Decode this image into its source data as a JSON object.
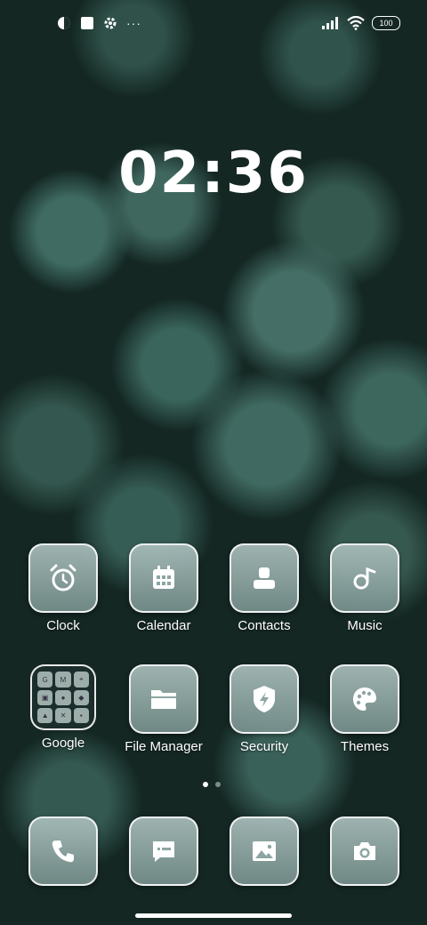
{
  "status_bar": {
    "icons_left": [
      "app-indicator-icon",
      "square-notification-icon",
      "gear-icon",
      "more-dots-icon"
    ],
    "more_label": "···",
    "icons_right": [
      "signal-icon",
      "wifi-icon",
      "battery-icon"
    ],
    "battery_level": "100"
  },
  "clock": {
    "time": "02:36"
  },
  "apps_row1": [
    {
      "label": "Clock",
      "icon": "alarm-clock-icon"
    },
    {
      "label": "Calendar",
      "icon": "calendar-icon"
    },
    {
      "label": "Contacts",
      "icon": "contacts-icon"
    },
    {
      "label": "Music",
      "icon": "music-note-icon"
    }
  ],
  "apps_row2": [
    {
      "label": "Google",
      "icon": "folder-icon"
    },
    {
      "label": "File Manager",
      "icon": "folder-open-icon"
    },
    {
      "label": "Security",
      "icon": "shield-bolt-icon"
    },
    {
      "label": "Themes",
      "icon": "palette-icon"
    }
  ],
  "google_folder_minis": [
    "G",
    "M",
    "⌖",
    "▣",
    "●",
    "◆",
    "▲",
    "✕",
    "▪"
  ],
  "dock": [
    {
      "icon": "phone-icon"
    },
    {
      "icon": "messages-icon"
    },
    {
      "icon": "gallery-icon"
    },
    {
      "icon": "camera-icon"
    }
  ],
  "page_indicator": {
    "pages": 2,
    "current": 1
  },
  "colors": {
    "tile_top": "#aabebc",
    "tile_bottom": "#78918e",
    "wallpaper_base": "#142723"
  }
}
